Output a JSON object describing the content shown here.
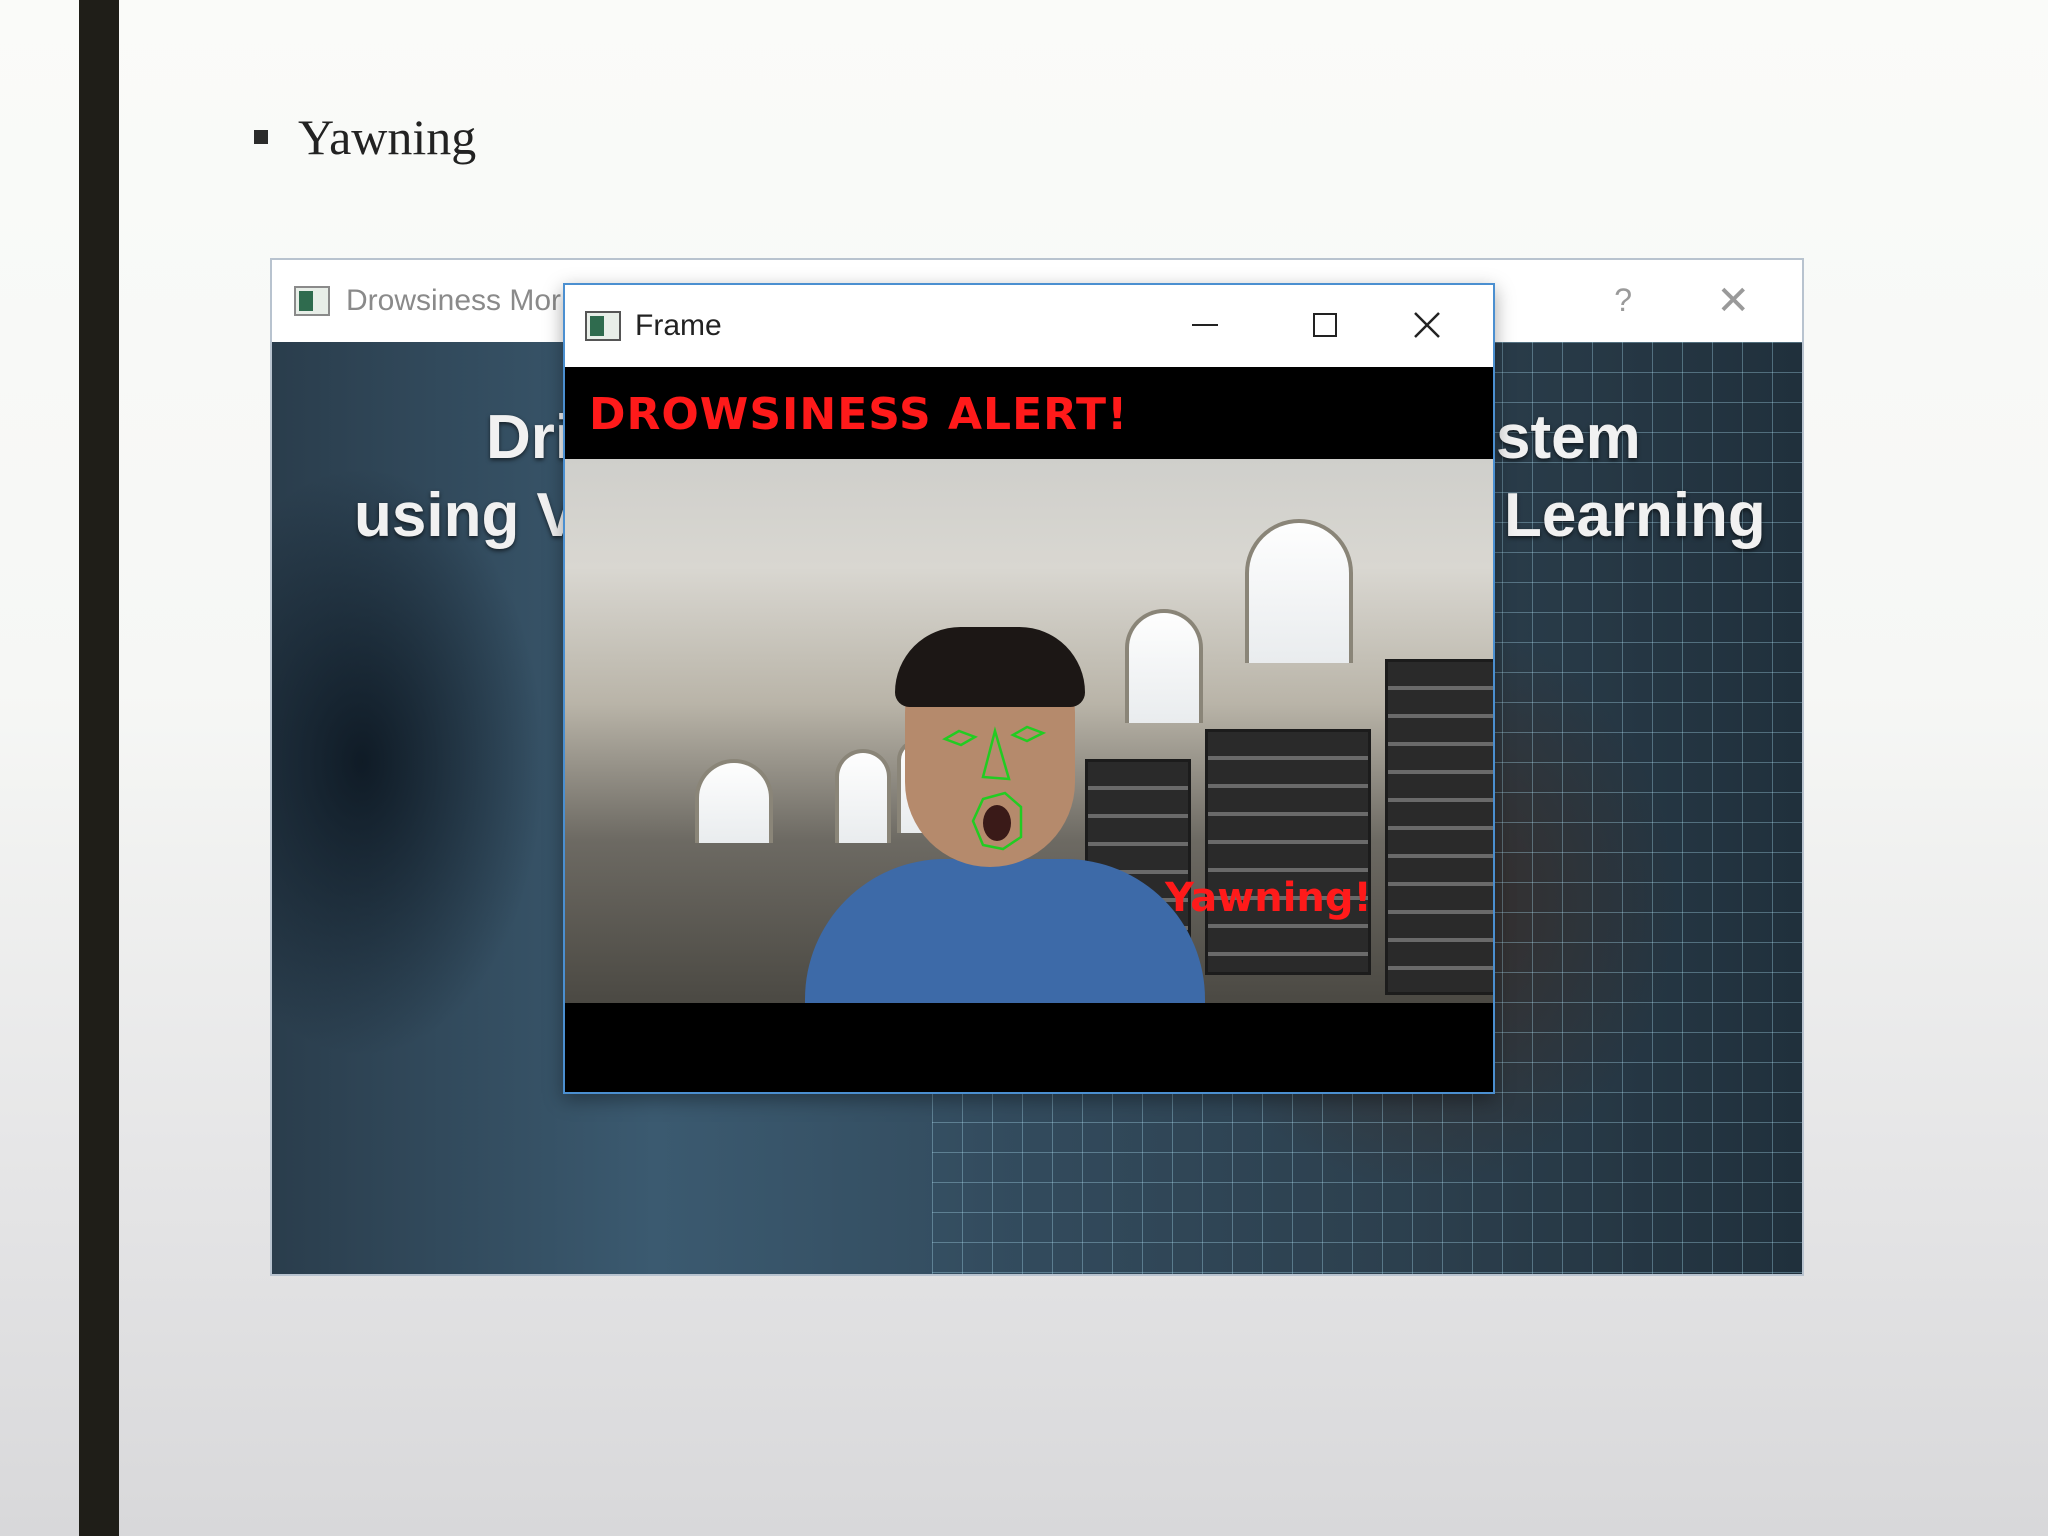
{
  "slide": {
    "bullet_text": "Yawning"
  },
  "back_window": {
    "title": "Drowsiness Mor",
    "help_label": "?",
    "close_label": "✕",
    "bg_title_line1_left": "Dri",
    "bg_title_line1_right": "stem",
    "bg_title_line2_left": "using V",
    "bg_title_line2_right": "Learning"
  },
  "front_window": {
    "title": "Frame",
    "close_label": "✕",
    "alert_text": "DROWSINESS ALERT!",
    "status_text": "Yawning!",
    "landmark_color": "#22cc22",
    "alert_color": "#ff1a1a"
  }
}
